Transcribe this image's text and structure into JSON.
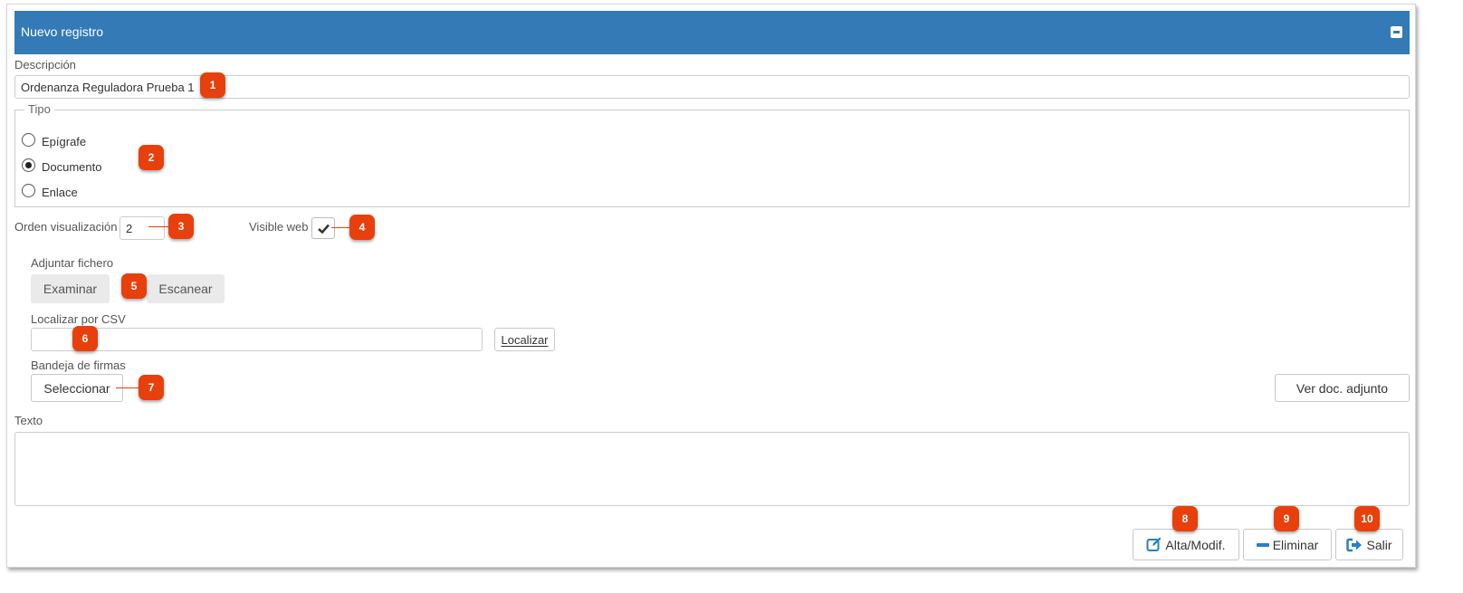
{
  "panel": {
    "title": "Nuevo registro",
    "collapse_icon": "minus-square-icon",
    "header_color": "#337ab7"
  },
  "descripcion": {
    "label": "Descripción",
    "value": "Ordenanza Reguladora Prueba 1"
  },
  "tipo": {
    "legend": "Tipo",
    "options": [
      {
        "label": "Epígrafe",
        "checked": false
      },
      {
        "label": "Documento",
        "checked": true
      },
      {
        "label": "Enlace",
        "checked": false
      }
    ]
  },
  "orden": {
    "label": "Orden visualización",
    "value": "2"
  },
  "visible_web": {
    "label": "Visible web",
    "checked": true
  },
  "adjuntar": {
    "label": "Adjuntar fichero",
    "examinar": "Examinar",
    "escanear": "Escanear"
  },
  "csv": {
    "label": "Localizar por CSV",
    "value": "",
    "button": "Localizar"
  },
  "bandeja": {
    "label": "Bandeja de firmas",
    "button": "Seleccionar"
  },
  "ver_doc": {
    "button": "Ver doc. adjunto"
  },
  "texto": {
    "label": "Texto",
    "value": ""
  },
  "actions": {
    "alta": {
      "label": "Alta/Modif.",
      "icon": "edit-icon"
    },
    "eliminar": {
      "label": "Eliminar",
      "icon": "minus-icon"
    },
    "salir": {
      "label": "Salir",
      "icon": "sign-out-icon"
    }
  },
  "callouts": [
    "1",
    "2",
    "3",
    "4",
    "5",
    "6",
    "7",
    "8",
    "9",
    "10"
  ],
  "colors": {
    "accent": "#337ab7",
    "callout": "#e8400c"
  }
}
